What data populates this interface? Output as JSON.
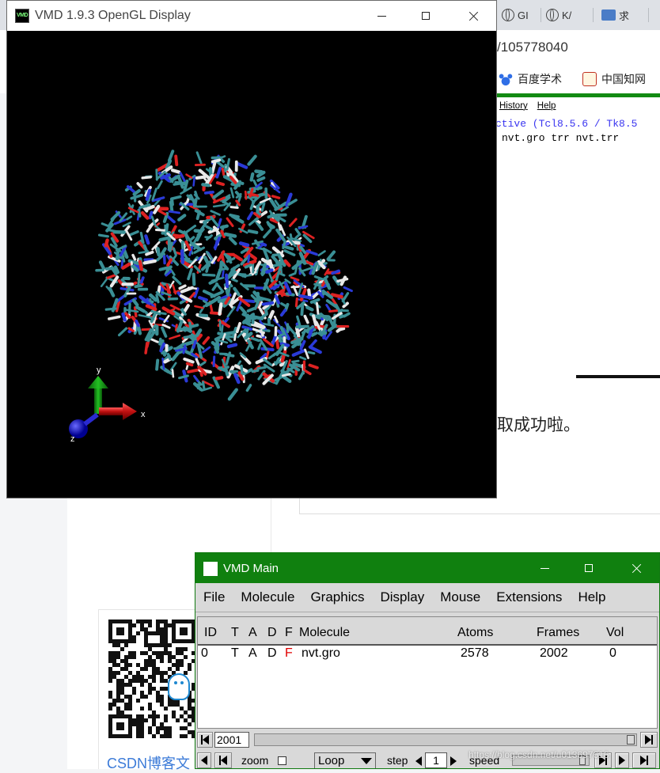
{
  "browser": {
    "tabs": [
      {
        "label": "GI"
      },
      {
        "label": "K/"
      },
      {
        "label": "求"
      }
    ],
    "url_fragment": "/105778040",
    "bookmarks": [
      {
        "label": "百度学术",
        "icon": "baidu-paw-icon"
      },
      {
        "label": "中国知网",
        "icon": "cnki-icon"
      }
    ]
  },
  "article": {
    "embedded_menu": [
      "History",
      "Help"
    ],
    "embedded_line1": "ctive (Tcl8.5.6 / Tk8.5",
    "embedded_line2": "nvt.gro trr nvt.trr",
    "text_fragment": "取成功啦。",
    "qr_caption": "CSDN博客文"
  },
  "gl_window": {
    "title": "VMD 1.9.3 OpenGL Display",
    "axes": {
      "x": "x",
      "y": "y",
      "z": "z"
    }
  },
  "main_window": {
    "title": "VMD Main",
    "menu": [
      "File",
      "Molecule",
      "Graphics",
      "Display",
      "Mouse",
      "Extensions",
      "Help"
    ],
    "columns": {
      "id": "ID",
      "t": "T",
      "a": "A",
      "d": "D",
      "f": "F",
      "molecule": "Molecule",
      "atoms": "Atoms",
      "frames": "Frames",
      "vol": "Vol"
    },
    "rows": [
      {
        "id": "0",
        "t": "T",
        "a": "A",
        "d": "D",
        "f": "F",
        "molecule": "nvt.gro",
        "atoms": "2578",
        "frames": "2002",
        "vol": "0"
      }
    ],
    "current_frame": "2001",
    "controls": {
      "zoom": "zoom",
      "loop": "Loop",
      "step_label": "step",
      "step": "1",
      "speed": "speed"
    },
    "colors": {
      "titlebar": "#10800f",
      "f_flag": "#e00000"
    }
  },
  "watermark": "https://blog.csdn.net/u013697616"
}
